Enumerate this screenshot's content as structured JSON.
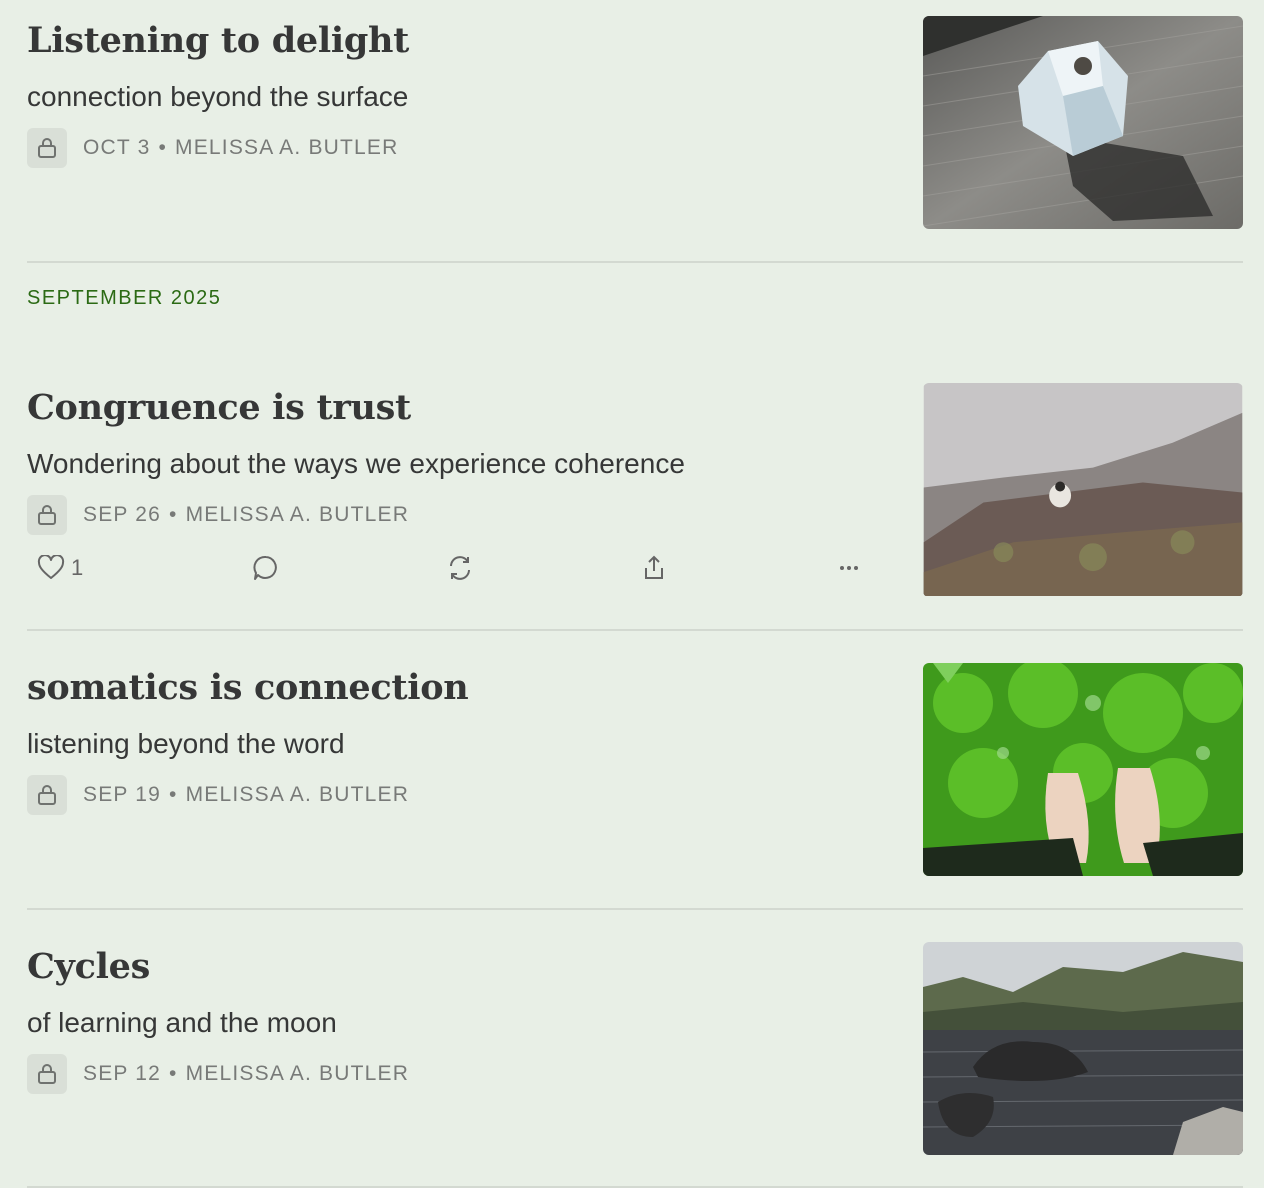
{
  "posts": [
    {
      "title": "Listening to delight",
      "subtitle": "connection beyond the surface",
      "date": "OCT 3",
      "author": "MELISSA A. BUTLER"
    },
    {
      "title": "Congruence is trust",
      "subtitle": "Wondering about the ways we experience coherence",
      "date": "SEP 26",
      "author": "MELISSA A. BUTLER",
      "likes": "1"
    },
    {
      "title": "somatics is connection",
      "subtitle": "listening beyond the word",
      "date": "SEP 19",
      "author": "MELISSA A. BUTLER"
    },
    {
      "title": "Cycles",
      "subtitle": "of learning and the moon",
      "date": "SEP 12",
      "author": "MELISSA A. BUTLER"
    }
  ],
  "section_label": "SEPTEMBER 2025",
  "meta_separator": "•",
  "icons": {
    "lock": "lock-icon",
    "like": "heart-icon",
    "comment": "comment-icon",
    "restack": "restack-icon",
    "share": "share-icon",
    "more": "more-icon"
  },
  "colors": {
    "background": "#e8efe6",
    "section_label": "#2b6a14",
    "meta": "#787a78"
  }
}
